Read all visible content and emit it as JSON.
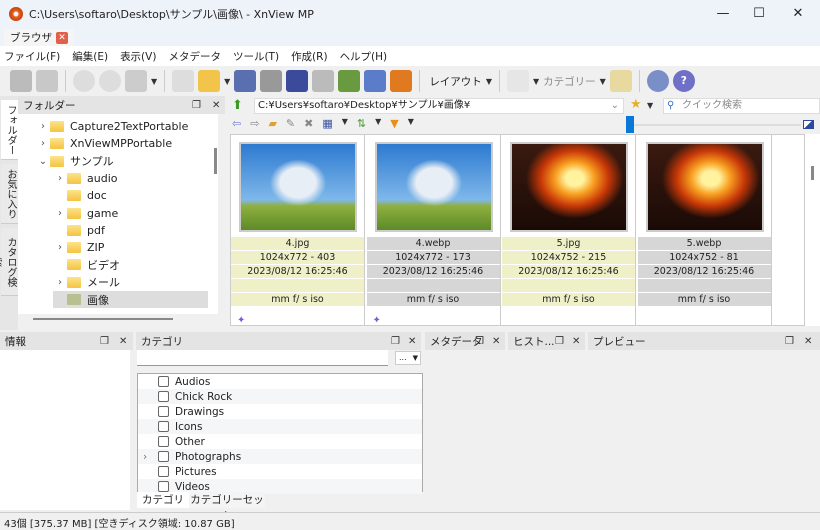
{
  "window": {
    "title": "C:\\Users\\softaro\\Desktop\\サンプル\\画像\\ - XnView MP",
    "controls": [
      "minimize",
      "maximize",
      "close"
    ]
  },
  "tab": {
    "label": "ブラウザ"
  },
  "menu": [
    "ファイル(F)",
    "編集(E)",
    "表示(V)",
    "メタデータ",
    "ツール(T)",
    "作成(R)",
    "ヘルプ(H)"
  ],
  "toolbar": {
    "layout_label": "レイアウト",
    "category_label": "カテゴリー"
  },
  "side_tabs": [
    "フォルダー",
    "お気に入り",
    "カタログ検索"
  ],
  "folder_panel": {
    "title": "フォルダー",
    "items": [
      {
        "label": "Capture2TextPortable",
        "expandable": true,
        "level": 0
      },
      {
        "label": "XnViewMPPortable",
        "expandable": true,
        "level": 0
      },
      {
        "label": "サンプル",
        "expanded": true,
        "level": 0
      },
      {
        "label": "audio",
        "expandable": true,
        "level": 1
      },
      {
        "label": "doc",
        "level": 1
      },
      {
        "label": "game",
        "expandable": true,
        "level": 1
      },
      {
        "label": "pdf",
        "level": 1
      },
      {
        "label": "ZIP",
        "expandable": true,
        "level": 1
      },
      {
        "label": "ビデオ",
        "level": 1
      },
      {
        "label": "メール",
        "expandable": true,
        "level": 1
      },
      {
        "label": "画像",
        "level": 1,
        "selected": true
      }
    ]
  },
  "browser": {
    "path": "C:¥Users¥softaro¥Desktop¥サンプル¥画像¥",
    "search_placeholder": "クイック検索",
    "files": [
      {
        "name": "4.jpg",
        "dims": "1024x772 - 403",
        "date": "2023/08/12 16:25:46",
        "exif": "mm f/ s iso",
        "image": "tree",
        "selected": true
      },
      {
        "name": "4.webp",
        "dims": "1024x772 - 173",
        "date": "2023/08/12 16:25:46",
        "exif": "mm f/ s iso",
        "image": "tree"
      },
      {
        "name": "5.jpg",
        "dims": "1024x752 - 215",
        "date": "2023/08/12 16:25:46",
        "exif": "mm f/ s iso",
        "image": "fire",
        "selected": true
      },
      {
        "name": "5.webp",
        "dims": "1024x752 - 81",
        "date": "2023/08/12 16:25:46",
        "exif": "mm f/ s iso",
        "image": "fire"
      }
    ]
  },
  "panels": {
    "info": "情報",
    "category": "カテゴリ",
    "metadata": "メタデータ",
    "history": "ヒスト...",
    "preview": "プレビュー"
  },
  "category": {
    "input_value": "",
    "more_button": "...",
    "items": [
      "Audios",
      "Chick Rock",
      "Drawings",
      "Icons",
      "Other",
      "Photographs",
      "Pictures",
      "Videos"
    ],
    "tabs": [
      "カテゴリ",
      "カテゴリーセット"
    ]
  },
  "status": "43個 [375.37 MB] [空きディスク領域: 10.87 GB]"
}
